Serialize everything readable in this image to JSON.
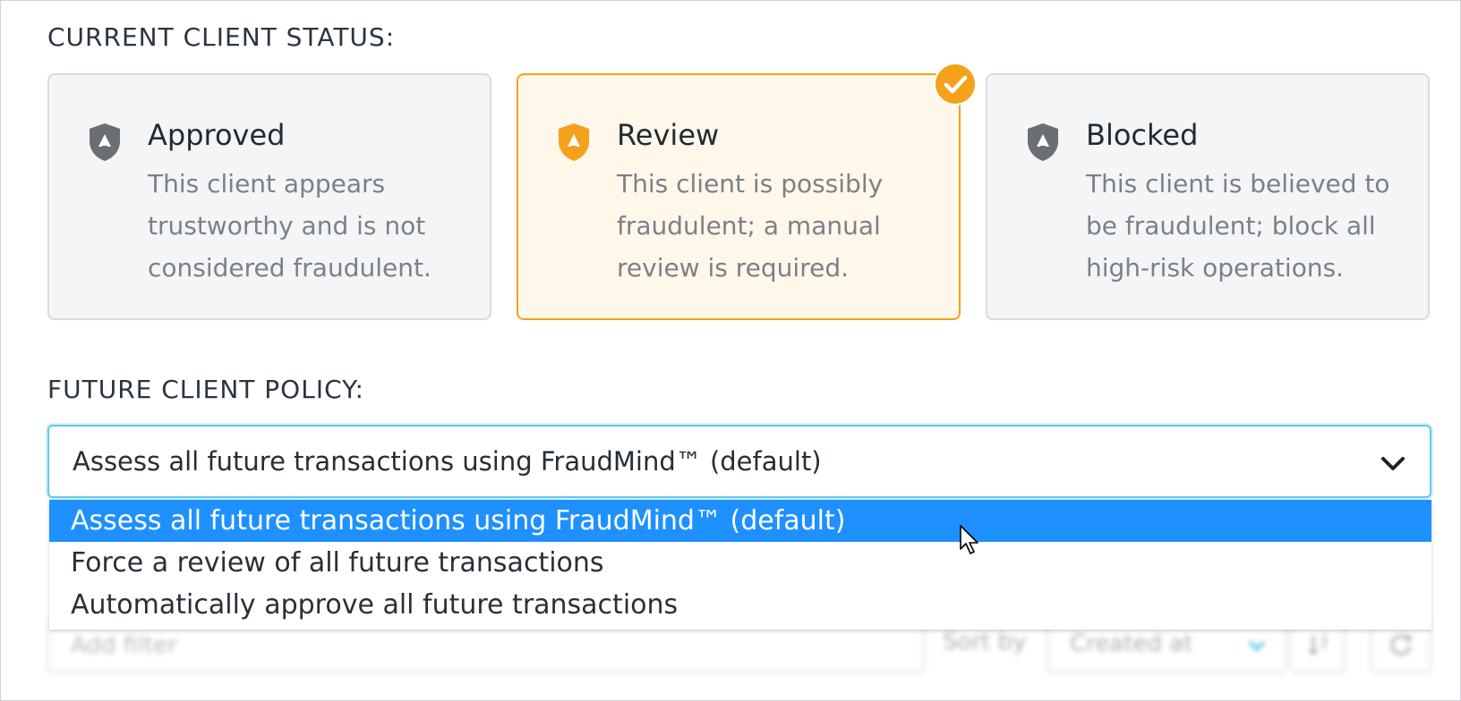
{
  "status_section": {
    "label": "CURRENT CLIENT STATUS:",
    "cards": [
      {
        "title": "Approved",
        "description": "This client appears trustworthy and is not considered fraudulent.",
        "icon": "shield-icon",
        "selected": false
      },
      {
        "title": "Review",
        "description": "This client is possibly fraudulent; a manual review is required.",
        "icon": "shield-icon",
        "selected": true
      },
      {
        "title": "Blocked",
        "description": "This client is believed to be fraudulent; block all high-risk operations.",
        "icon": "shield-icon",
        "selected": false
      }
    ],
    "selected_icon": "check-circle-icon"
  },
  "policy_section": {
    "label": "FUTURE CLIENT POLICY:",
    "selected_value": "Assess all future transactions using FraudMind™ (default)",
    "options": [
      "Assess all future transactions using FraudMind™ (default)",
      "Force a review of all future transactions",
      "Automatically approve all future transactions"
    ],
    "highlighted_option": 0
  },
  "background_toolbar": {
    "filter_placeholder": "Add filter",
    "sort_label": "Sort by",
    "sort_value": "Created at"
  },
  "colors": {
    "accent_orange": "#f5a11c",
    "highlight_blue": "#1e90ff",
    "focus_cyan": "#5ec9ef",
    "icon_gray": "#6b6e72"
  }
}
